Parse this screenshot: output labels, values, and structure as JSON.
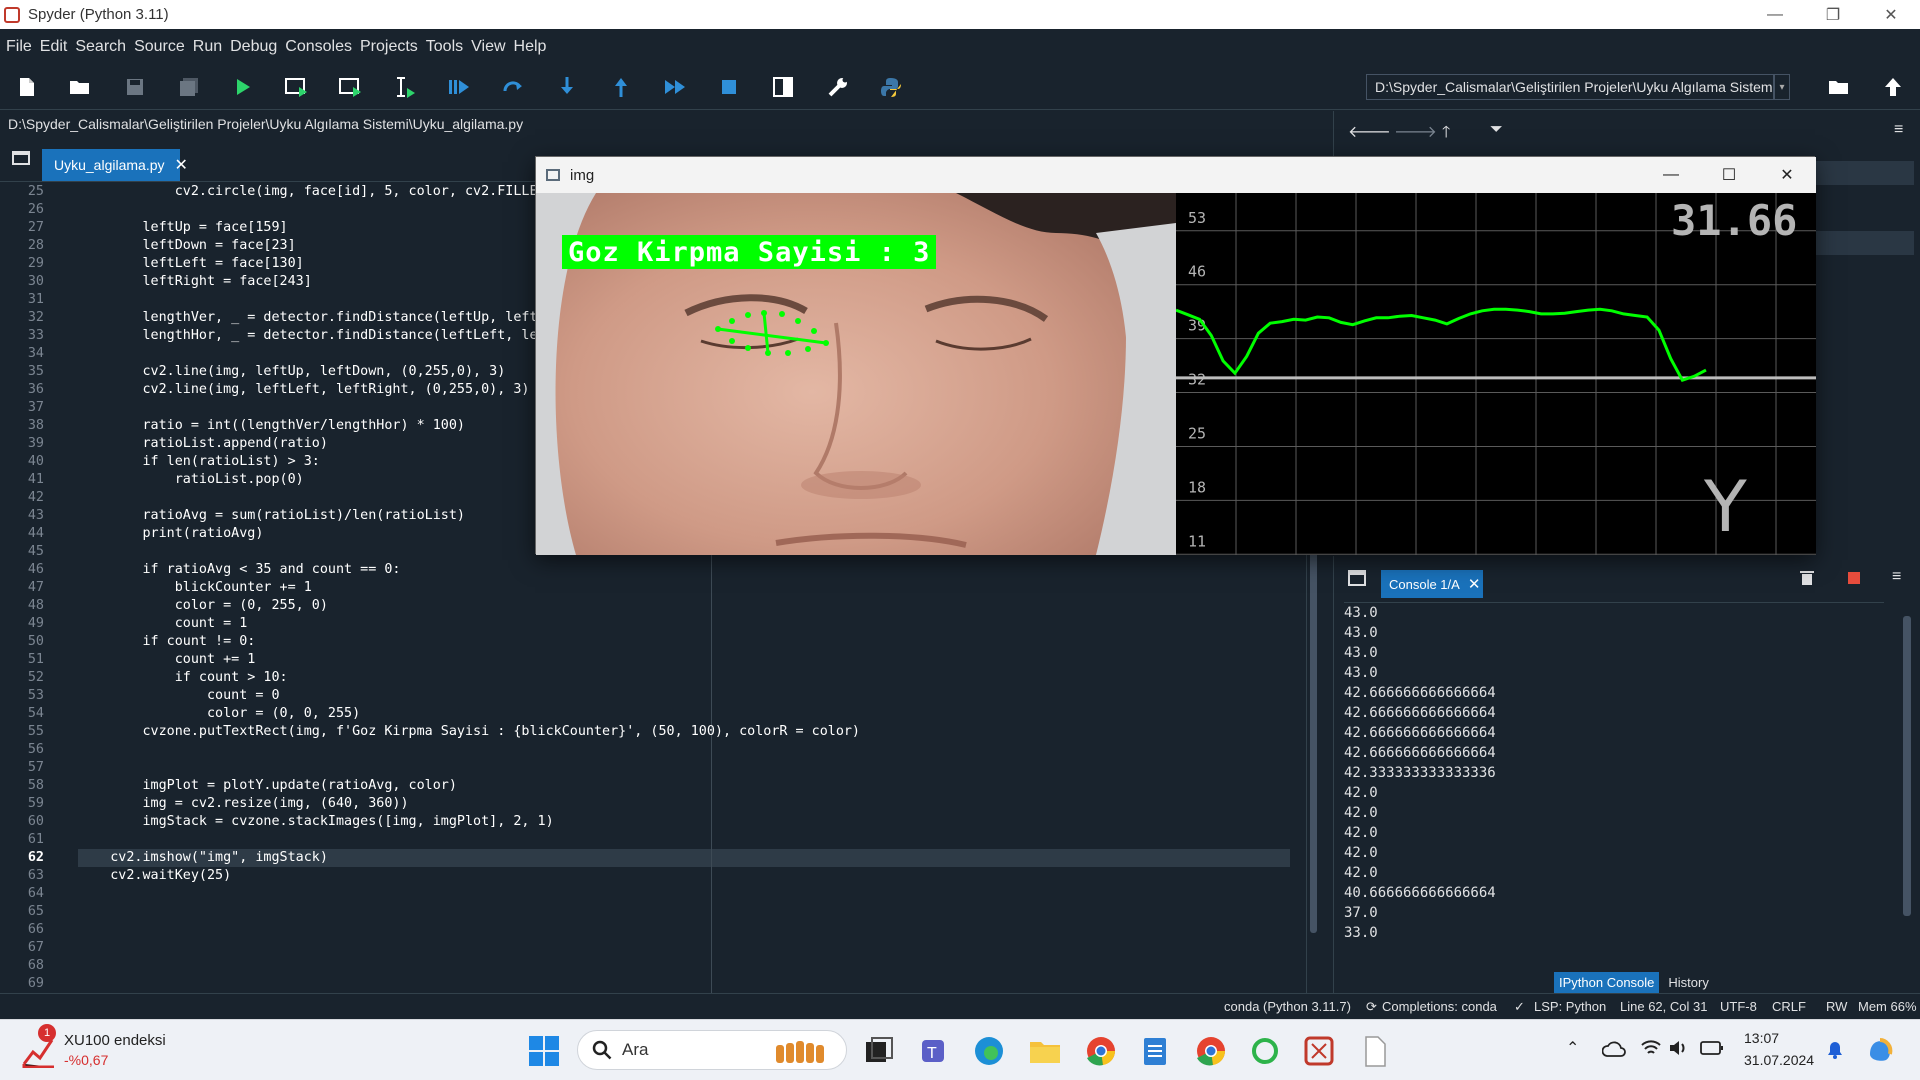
{
  "window": {
    "title": "Spyder (Python 3.11)",
    "min": "—",
    "max": "❐",
    "close": "✕"
  },
  "menu": [
    "File",
    "Edit",
    "Search",
    "Source",
    "Run",
    "Debug",
    "Consoles",
    "Projects",
    "Tools",
    "View",
    "Help"
  ],
  "toolbar": {
    "working_dir": "D:\\Spyder_Calismalar\\Geliştirilen Projeler\\Uyku Algılama Sistemi"
  },
  "editor": {
    "file_path": "D:\\Spyder_Calismalar\\Geliştirilen Projeler\\Uyku Algılama Sistemi\\Uyku_algilama.py",
    "tab_label": "Uyku_algilama.py",
    "current_line": 62,
    "line_numbers": [
      "25",
      "26",
      "27",
      "28",
      "29",
      "30",
      "31",
      "32",
      "33",
      "34",
      "35",
      "36",
      "37",
      "38",
      "39",
      "40",
      "41",
      "42",
      "43",
      "44",
      "45",
      "46",
      "47",
      "48",
      "49",
      "50",
      "51",
      "52",
      "53",
      "54",
      "55",
      "56",
      "57",
      "58",
      "59",
      "60",
      "61",
      "62",
      "63",
      "64",
      "65",
      "66",
      "67",
      "68",
      "69"
    ],
    "lines": [
      "            cv2.circle(img, face[id], 5, color, cv2.FILLE",
      "",
      "        leftUp = face[159]",
      "        leftDown = face[23]",
      "        leftLeft = face[130]",
      "        leftRight = face[243]",
      "",
      "        lengthVer, _ = detector.findDistance(leftUp, left",
      "        lengthHor, _ = detector.findDistance(leftLeft, le",
      "",
      "        cv2.line(img, leftUp, leftDown, (0,255,0), 3)",
      "        cv2.line(img, leftLeft, leftRight, (0,255,0), 3)",
      "",
      "        ratio = int((lengthVer/lengthHor) * 100)",
      "        ratioList.append(ratio)",
      "        if len(ratioList) > 3:",
      "            ratioList.pop(0)",
      "",
      "        ratioAvg = sum(ratioList)/len(ratioList)",
      "        print(ratioAvg)",
      "",
      "        if ratioAvg < 35 and count == 0:",
      "            blickCounter += 1",
      "            color = (0, 255, 0)",
      "            count = 1",
      "        if count != 0:",
      "            count += 1",
      "            if count > 10:",
      "                count = 0",
      "                color = (0, 0, 255)",
      "        cvzone.putTextRect(img, f'Goz Kirpma Sayisi : {blickCounter}', (50, 100), colorR = color)",
      "",
      "",
      "        imgPlot = plotY.update(ratioAvg, color)",
      "        img = cv2.resize(img, (640, 360))",
      "        imgStack = cvzone.stackImages([img, imgPlot], 2, 1)",
      "",
      "    cv2.imshow(\"img\", imgStack)",
      "    cv2.waitKey(25)",
      "",
      "",
      "",
      "",
      "",
      ""
    ]
  },
  "img_window": {
    "title": "img",
    "overlay_text": "Goz Kirpma Sayisi : 3",
    "plot_value": "31.66",
    "plot_letter": "Y",
    "y_ticks": [
      "53",
      "46",
      "39",
      "32",
      "25",
      "18",
      "11"
    ]
  },
  "chart_data": {
    "type": "line",
    "title": "",
    "xlabel": "",
    "ylabel": "",
    "ylim": [
      10,
      57
    ],
    "reference_line": 33,
    "series": [
      {
        "values": [
          41.8,
          41.2,
          40.6,
          38.5,
          35.2,
          33.6,
          35.8,
          38.8,
          40.1,
          40.3,
          40.6,
          40.5,
          40.9,
          40.8,
          40.2,
          39.9,
          40.4,
          40.8,
          40.8,
          41.0,
          41.1,
          40.8,
          40.5,
          40.0,
          40.7,
          41.3,
          41.7,
          41.9,
          41.9,
          41.8,
          41.6,
          41.3,
          41.3,
          41.4,
          41.6,
          41.8,
          41.9,
          41.7,
          41.3,
          41.1,
          40.9,
          39.2,
          35.5,
          32.7,
          33.2,
          34.0
        ]
      }
    ],
    "color": "#00ff00"
  },
  "console": {
    "tab_label": "Console 1/A",
    "output": [
      "43.0",
      "43.0",
      "43.0",
      "43.0",
      "42.666666666666664",
      "42.666666666666664",
      "42.666666666666664",
      "42.666666666666664",
      "42.333333333333336",
      "42.0",
      "42.0",
      "42.0",
      "42.0",
      "42.0",
      "40.666666666666664",
      "37.0",
      "33.0"
    ],
    "bottom_tabs": [
      "IPython Console",
      "History"
    ]
  },
  "statusbar": {
    "env": "conda (Python 3.11.7)",
    "completions": "Completions: conda",
    "lsp": "LSP: Python",
    "position": "Line 62, Col 31",
    "encoding": "UTF-8",
    "eol": "CRLF",
    "perm": "RW",
    "mem": "Mem 66%"
  },
  "taskbar": {
    "stock_name": "XU100 endeksi",
    "stock_change": "-%0,67",
    "stock_badge": "1",
    "search_placeholder": "Ara",
    "time": "13:07",
    "date": "31.07.2024"
  },
  "colors": {
    "accent": "#1a72bb",
    "bg": "#19232d",
    "plot_green": "#00ff00"
  }
}
